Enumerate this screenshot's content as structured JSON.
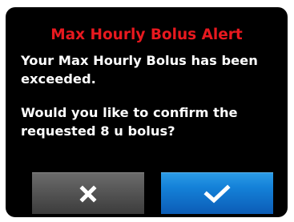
{
  "alert": {
    "title": "Max Hourly Bolus Alert",
    "message_line1": "Your Max Hourly Bolus has been",
    "message_line2": "exceeded.",
    "question_line1": "Would you like to confirm the",
    "question_line2": "requested 8 u bolus?"
  },
  "buttons": {
    "cancel_icon": "close-icon",
    "confirm_icon": "checkmark-icon"
  },
  "colors": {
    "title": "#e8191f",
    "text": "#ffffff",
    "background": "#000000",
    "cancel_button": "#5a5a5a",
    "confirm_button": "#1481d8"
  }
}
